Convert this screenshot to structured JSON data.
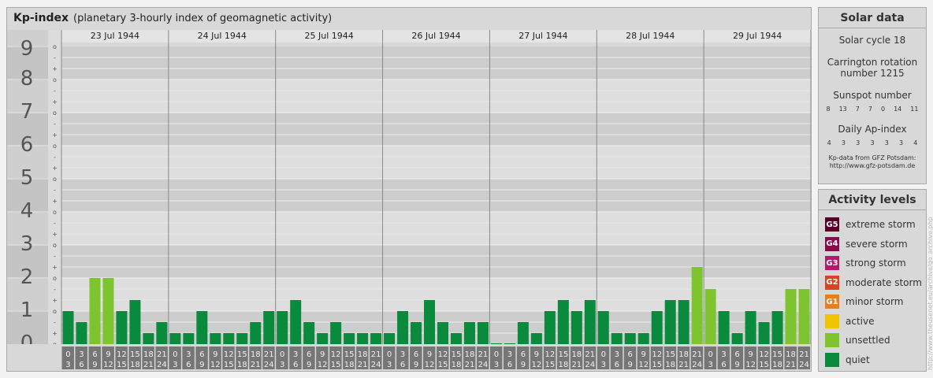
{
  "title": "Kp-index",
  "subtitle": "(planetary 3-hourly index of geomagnetic activity)",
  "chart_data": {
    "type": "bar",
    "title": "Kp-index",
    "subtitle": "(planetary 3-hourly index of geomagnetic activity)",
    "ylim": [
      0,
      9
    ],
    "y_major_ticks": [
      "0",
      "1",
      "2",
      "3",
      "4",
      "5",
      "6",
      "7",
      "8",
      "9"
    ],
    "y_minor_ticks": [
      "o",
      "+",
      "-",
      "o",
      "+",
      "-",
      "o",
      "+",
      "-",
      "o",
      "+",
      "-",
      "o",
      "+",
      "-",
      "o",
      "+",
      "-",
      "o",
      "+",
      "-",
      "o",
      "+",
      "-",
      "o",
      "+",
      "-",
      "o"
    ],
    "days": [
      "23 Jul 1944",
      "24 Jul 1944",
      "25 Jul 1944",
      "26 Jul 1944",
      "27 Jul 1944",
      "28 Jul 1944",
      "29 Jul 1944"
    ],
    "interval_start": [
      "0",
      "3",
      "6",
      "9",
      "12",
      "15",
      "18",
      "21"
    ],
    "interval_end": [
      "3",
      "6",
      "9",
      "12",
      "15",
      "18",
      "21",
      "24"
    ],
    "values": [
      [
        1,
        0.667,
        2,
        2,
        1,
        1.333,
        0.333,
        0.667
      ],
      [
        0.333,
        0.333,
        1,
        0.333,
        0.333,
        0.333,
        0.667,
        1
      ],
      [
        1,
        1.333,
        0.667,
        0.333,
        0.667,
        0.333,
        0.333,
        0.333
      ],
      [
        0.333,
        1,
        0.667,
        1.333,
        0.667,
        0.333,
        0.667,
        0.667
      ],
      [
        0,
        0,
        0.667,
        0.333,
        1,
        1.333,
        1,
        1.333
      ],
      [
        1,
        0.333,
        0.333,
        0.333,
        1,
        1.333,
        1.333,
        2.333
      ],
      [
        1.667,
        1,
        0.333,
        1,
        0.667,
        1,
        1.667,
        1.667
      ]
    ],
    "colors": {
      "quiet": "#0a8a3c",
      "unsettled": "#7dc42e"
    },
    "grid": true
  },
  "solar": {
    "title": "Solar data",
    "cycle": "Solar cycle 18",
    "carrington_1": "Carrington rotation",
    "carrington_2": "number 1215",
    "sunspot_label": "Sunspot number",
    "sunspot": [
      "8",
      "13",
      "7",
      "7",
      "0",
      "14",
      "11"
    ],
    "ap_label": "Daily Ap-index",
    "ap": [
      "4",
      "3",
      "3",
      "3",
      "3",
      "3",
      "4"
    ],
    "source_1": "Kp-data from GFZ Potsdam:",
    "source_2": "http://www.gfz-potsdam.de"
  },
  "activity": {
    "title": "Activity levels",
    "items": [
      {
        "code": "G5",
        "label": "extreme storm",
        "color": "#5a0026"
      },
      {
        "code": "G4",
        "label": "severe storm",
        "color": "#8a0a4e"
      },
      {
        "code": "G3",
        "label": "strong storm",
        "color": "#b8176e"
      },
      {
        "code": "G2",
        "label": "moderate storm",
        "color": "#d9431f"
      },
      {
        "code": "G1",
        "label": "minor storm",
        "color": "#e87f1c"
      },
      {
        "code": "",
        "label": "active",
        "color": "#f2c400"
      },
      {
        "code": "",
        "label": "unsettled",
        "color": "#7dc42e"
      },
      {
        "code": "",
        "label": "quiet",
        "color": "#0a8a3c"
      }
    ]
  },
  "watermark": "http://www.theusenet.eu/archive/go_archive.php"
}
